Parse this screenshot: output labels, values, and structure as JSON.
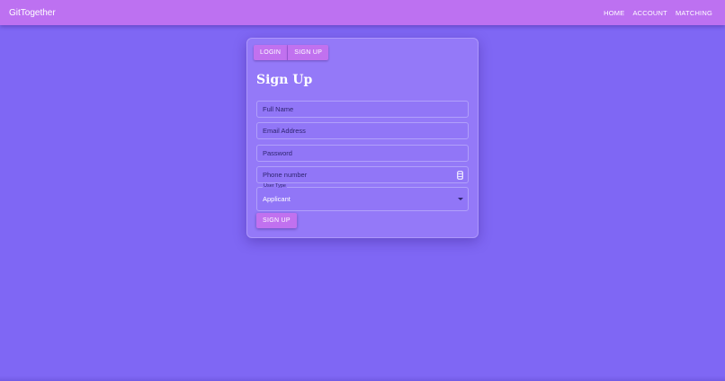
{
  "appbar": {
    "brand": "GitTogether",
    "nav": [
      {
        "label": "HOME"
      },
      {
        "label": "ACCOUNT"
      },
      {
        "label": "MATCHING"
      }
    ],
    "color": "#bd71f1"
  },
  "card": {
    "tabs": [
      {
        "label": "LOGIN"
      },
      {
        "label": "SIGN UP"
      }
    ],
    "title": "Sign Up",
    "fields": {
      "full_name": {
        "placeholder": "Full Name"
      },
      "email": {
        "placeholder": "Email Address"
      },
      "password": {
        "placeholder": "Password"
      },
      "phone": {
        "placeholder": "Phone number",
        "trailing_icon": "phone-icon"
      }
    },
    "user_type": {
      "label": "User Type",
      "selected": "Applicant"
    },
    "submit_label": "SIGN UP"
  },
  "colors": {
    "background": "#7f67f4",
    "card": "#9479f8",
    "accent": "#c171ef"
  }
}
